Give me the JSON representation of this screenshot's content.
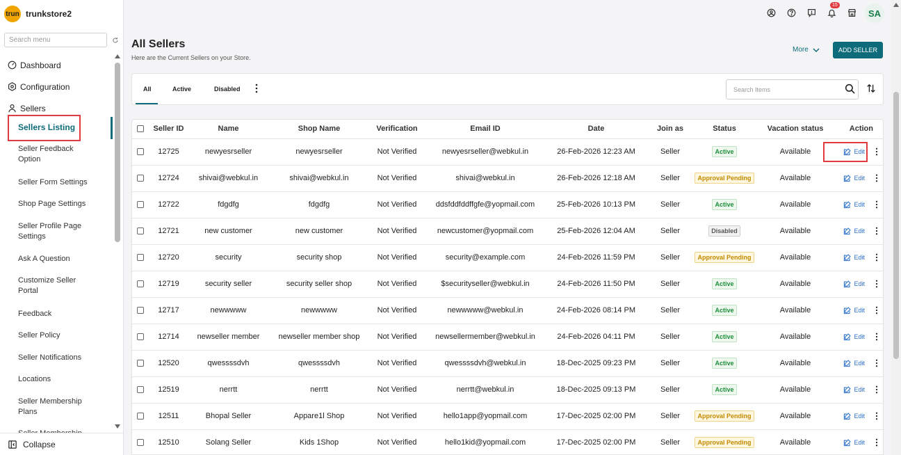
{
  "brand": {
    "logo_text": "trun",
    "store_name": "trunkstore2"
  },
  "sidebar": {
    "search_placeholder": "Search menu",
    "top_items": [
      {
        "label": "Dashboard",
        "icon": "dashboard-icon"
      },
      {
        "label": "Configuration",
        "icon": "configuration-icon"
      },
      {
        "label": "Sellers",
        "icon": "user-icon"
      }
    ],
    "sub_items": [
      "Sellers Listing",
      "Seller Feedback Option",
      "Seller Form Settings",
      "Shop Page Settings",
      "Seller Profile Page Settings",
      "Ask A Question",
      "Customize Seller Portal",
      "Feedback",
      "Seller Policy",
      "Seller Notifications",
      "Locations",
      "Seller Membership Plans",
      "Seller Membership"
    ],
    "collapse_label": "Collapse"
  },
  "topbar": {
    "notification_count": "15",
    "avatar_initials": "SA"
  },
  "page": {
    "title": "All Sellers",
    "subtitle": "Here are the Current Sellers on your Store.",
    "more_label": "More",
    "add_button": "ADD SELLER"
  },
  "tabs": [
    "All",
    "Active",
    "Disabled"
  ],
  "search_items_placeholder": "Search Items",
  "table": {
    "headers": [
      "Seller ID",
      "Name",
      "Shop Name",
      "Verification",
      "Email ID",
      "Date",
      "Join as",
      "Status",
      "Vacation status",
      "Action"
    ],
    "edit_label": "Edit",
    "rows": [
      [
        "12725",
        "newyesrseller",
        "newyesrseller",
        "Not Verified",
        "newyesrseller@webkul.in",
        "26-Feb-2026 12:23 AM",
        "Seller",
        "Active",
        "Available"
      ],
      [
        "12724",
        "shivai@webkul.in",
        "shivai@webkul.in",
        "Not Verified",
        "shivai@webkul.in",
        "26-Feb-2026 12:18 AM",
        "Seller",
        "Approval Pending",
        "Available"
      ],
      [
        "12722",
        "fdgdfg",
        "fdgdfg",
        "Not Verified",
        "ddsfddfddffgfe@yopmail.com",
        "25-Feb-2026 10:13 PM",
        "Seller",
        "Active",
        "Available"
      ],
      [
        "12721",
        "new customer",
        "new customer",
        "Not Verified",
        "newcustomer@yopmail.com",
        "25-Feb-2026 12:04 AM",
        "Seller",
        "Disabled",
        "Available"
      ],
      [
        "12720",
        "security",
        "security shop",
        "Not Verified",
        "security@example.com",
        "24-Feb-2026 11:59 PM",
        "Seller",
        "Approval Pending",
        "Available"
      ],
      [
        "12719",
        "security seller",
        "security seller shop",
        "Not Verified",
        "$securityseller@webkul.in",
        "24-Feb-2026 11:50 PM",
        "Seller",
        "Active",
        "Available"
      ],
      [
        "12717",
        "newwwww",
        "newwwww",
        "Not Verified",
        "newwwww@webkul.in",
        "24-Feb-2026 08:14 PM",
        "Seller",
        "Active",
        "Available"
      ],
      [
        "12714",
        "newseller member",
        "newseller member shop",
        "Not Verified",
        "newsellermember@webkul.in",
        "24-Feb-2026 04:11 PM",
        "Seller",
        "Active",
        "Available"
      ],
      [
        "12520",
        "qwessssdvh",
        "qwessssdvh",
        "Not Verified",
        "qwessssdvh@webkul.in",
        "18-Dec-2025 09:23 PM",
        "Seller",
        "Active",
        "Available"
      ],
      [
        "12519",
        "nerrtt",
        "nerrtt",
        "Not Verified",
        "nerrtt@webkul.in",
        "18-Dec-2025 09:13 PM",
        "Seller",
        "Active",
        "Available"
      ],
      [
        "12511",
        "Bhopal Seller",
        "Appare1l Shop",
        "Not Verified",
        "hello1app@yopmail.com",
        "17-Dec-2025 02:00 PM",
        "Seller",
        "Approval Pending",
        "Available"
      ],
      [
        "12510",
        "Solang Seller",
        "Kids 1Shop",
        "Not Verified",
        "hello1kid@yopmail.com",
        "17-Dec-2025 02:00 PM",
        "Seller",
        "Approval Pending",
        "Available"
      ]
    ]
  }
}
